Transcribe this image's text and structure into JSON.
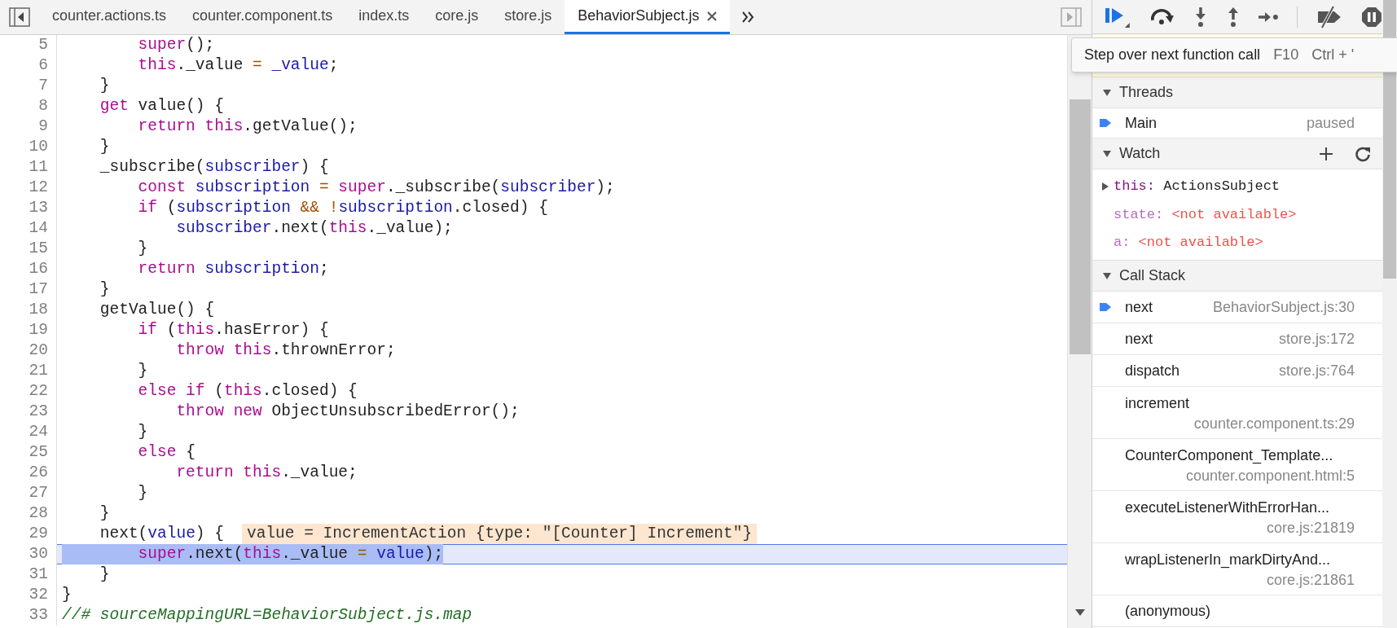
{
  "tabs": [
    {
      "label": "counter.actions.ts",
      "selected": false
    },
    {
      "label": "counter.component.ts",
      "selected": false
    },
    {
      "label": "index.ts",
      "selected": false
    },
    {
      "label": "core.js",
      "selected": false
    },
    {
      "label": "store.js",
      "selected": false
    },
    {
      "label": "BehaviorSubject.js",
      "selected": true
    }
  ],
  "editor": {
    "lines": [
      {
        "number": "5",
        "current": false,
        "tokens": [
          {
            "text": "        super",
            "kind": "keyword"
          },
          {
            "text": "();",
            "kind": "plain"
          }
        ]
      },
      {
        "number": "6",
        "current": false,
        "tokens": [
          {
            "text": "        this",
            "kind": "keyword"
          },
          {
            "text": "._value",
            "kind": "plain"
          },
          {
            "text": " =",
            "kind": "operator"
          },
          {
            "text": " _value",
            "kind": "variable"
          },
          {
            "text": ";",
            "kind": "plain"
          }
        ]
      },
      {
        "number": "7",
        "current": false,
        "tokens": [
          {
            "text": "    }",
            "kind": "plain"
          }
        ]
      },
      {
        "number": "8",
        "current": false,
        "tokens": [
          {
            "text": "    get",
            "kind": "keyword"
          },
          {
            "text": " value() {",
            "kind": "plain"
          }
        ]
      },
      {
        "number": "9",
        "current": false,
        "tokens": [
          {
            "text": "        return",
            "kind": "keyword"
          },
          {
            "text": " this",
            "kind": "keyword"
          },
          {
            "text": ".getValue();",
            "kind": "plain"
          }
        ]
      },
      {
        "number": "10",
        "current": false,
        "tokens": [
          {
            "text": "    }",
            "kind": "plain"
          }
        ]
      },
      {
        "number": "11",
        "current": false,
        "tokens": [
          {
            "text": "    _subscribe(",
            "kind": "plain"
          },
          {
            "text": "subscriber",
            "kind": "variable"
          },
          {
            "text": ") {",
            "kind": "plain"
          }
        ]
      },
      {
        "number": "12",
        "current": false,
        "tokens": [
          {
            "text": "        const",
            "kind": "keyword"
          },
          {
            "text": " subscription",
            "kind": "variable"
          },
          {
            "text": " =",
            "kind": "operator"
          },
          {
            "text": " super",
            "kind": "keyword"
          },
          {
            "text": "._subscribe(",
            "kind": "plain"
          },
          {
            "text": "subscriber",
            "kind": "variable"
          },
          {
            "text": ");",
            "kind": "plain"
          }
        ]
      },
      {
        "number": "13",
        "current": false,
        "tokens": [
          {
            "text": "        if",
            "kind": "keyword"
          },
          {
            "text": " (",
            "kind": "plain"
          },
          {
            "text": "subscription",
            "kind": "variable"
          },
          {
            "text": " && !",
            "kind": "operator"
          },
          {
            "text": "subscription",
            "kind": "variable"
          },
          {
            "text": ".closed) {",
            "kind": "plain"
          }
        ]
      },
      {
        "number": "14",
        "current": false,
        "tokens": [
          {
            "text": "            subscriber",
            "kind": "variable"
          },
          {
            "text": ".next(",
            "kind": "plain"
          },
          {
            "text": "this",
            "kind": "keyword"
          },
          {
            "text": "._value);",
            "kind": "plain"
          }
        ]
      },
      {
        "number": "15",
        "current": false,
        "tokens": [
          {
            "text": "        }",
            "kind": "plain"
          }
        ]
      },
      {
        "number": "16",
        "current": false,
        "tokens": [
          {
            "text": "        return",
            "kind": "keyword"
          },
          {
            "text": " subscription",
            "kind": "variable"
          },
          {
            "text": ";",
            "kind": "plain"
          }
        ]
      },
      {
        "number": "17",
        "current": false,
        "tokens": [
          {
            "text": "    }",
            "kind": "plain"
          }
        ]
      },
      {
        "number": "18",
        "current": false,
        "tokens": [
          {
            "text": "    getValue() {",
            "kind": "plain"
          }
        ]
      },
      {
        "number": "19",
        "current": false,
        "tokens": [
          {
            "text": "        if",
            "kind": "keyword"
          },
          {
            "text": " (",
            "kind": "plain"
          },
          {
            "text": "this",
            "kind": "keyword"
          },
          {
            "text": ".hasError) {",
            "kind": "plain"
          }
        ]
      },
      {
        "number": "20",
        "current": false,
        "tokens": [
          {
            "text": "            throw",
            "kind": "keyword"
          },
          {
            "text": " this",
            "kind": "keyword"
          },
          {
            "text": ".thrownError;",
            "kind": "plain"
          }
        ]
      },
      {
        "number": "21",
        "current": false,
        "tokens": [
          {
            "text": "        }",
            "kind": "plain"
          }
        ]
      },
      {
        "number": "22",
        "current": false,
        "tokens": [
          {
            "text": "        else if",
            "kind": "keyword"
          },
          {
            "text": " (",
            "kind": "plain"
          },
          {
            "text": "this",
            "kind": "keyword"
          },
          {
            "text": ".closed) {",
            "kind": "plain"
          }
        ]
      },
      {
        "number": "23",
        "current": false,
        "tokens": [
          {
            "text": "            throw new",
            "kind": "keyword"
          },
          {
            "text": " ObjectUnsubscribedError();",
            "kind": "plain"
          }
        ]
      },
      {
        "number": "24",
        "current": false,
        "tokens": [
          {
            "text": "        }",
            "kind": "plain"
          }
        ]
      },
      {
        "number": "25",
        "current": false,
        "tokens": [
          {
            "text": "        else",
            "kind": "keyword"
          },
          {
            "text": " {",
            "kind": "plain"
          }
        ]
      },
      {
        "number": "26",
        "current": false,
        "tokens": [
          {
            "text": "            return this",
            "kind": "keyword"
          },
          {
            "text": "._value;",
            "kind": "plain"
          }
        ]
      },
      {
        "number": "27",
        "current": false,
        "tokens": [
          {
            "text": "        }",
            "kind": "plain"
          }
        ]
      },
      {
        "number": "28",
        "current": false,
        "tokens": [
          {
            "text": "    }",
            "kind": "plain"
          }
        ]
      },
      {
        "number": "29",
        "current": false,
        "tokens": [
          {
            "text": "    next(",
            "kind": "plain"
          },
          {
            "text": "value",
            "kind": "variable"
          },
          {
            "text": ") {",
            "kind": "plain"
          }
        ],
        "inline_value": "value = IncrementAction {type: \"[Counter] Increment\"}"
      },
      {
        "number": "30",
        "current": true,
        "tokens": [
          {
            "text": "        super",
            "kind": "keyword"
          },
          {
            "text": ".next(",
            "kind": "plain"
          },
          {
            "text": "this",
            "kind": "keyword"
          },
          {
            "text": "._value",
            "kind": "plain"
          },
          {
            "text": " =",
            "kind": "operator"
          },
          {
            "text": " value",
            "kind": "variable"
          },
          {
            "text": ");",
            "kind": "plain"
          }
        ]
      },
      {
        "number": "31",
        "current": false,
        "tokens": [
          {
            "text": "    }",
            "kind": "plain"
          }
        ]
      },
      {
        "number": "32",
        "current": false,
        "tokens": [
          {
            "text": "}",
            "kind": "plain"
          }
        ]
      },
      {
        "number": "33",
        "current": false,
        "tokens": [
          {
            "text": "//# sourceMappingURL=BehaviorSubject.js.map",
            "kind": "comment"
          }
        ]
      }
    ]
  },
  "debugger": {
    "tooltip": {
      "text": "Step over next function call",
      "shortcuts": [
        "F10",
        "Ctrl + '"
      ]
    },
    "threads": {
      "title": "Threads",
      "expanded": true,
      "items": [
        {
          "name": "Main",
          "status": "paused",
          "current": true
        }
      ]
    },
    "watch": {
      "title": "Watch",
      "expanded": true,
      "items": [
        {
          "kind": "object",
          "name": "this:",
          "value": "ActionsSubject",
          "expanded": false
        },
        {
          "kind": "unavailable",
          "name": "state:",
          "value": "<not available>"
        },
        {
          "kind": "unavailable",
          "name": "a:",
          "value": "<not available>"
        }
      ]
    },
    "call_stack": {
      "title": "Call Stack",
      "expanded": true,
      "frames": [
        {
          "kind": "inline",
          "name": "next",
          "location": "BehaviorSubject.js:30",
          "current": true
        },
        {
          "kind": "inline",
          "name": "next",
          "location": "store.js:172",
          "current": false
        },
        {
          "kind": "inline",
          "name": "dispatch",
          "location": "store.js:764",
          "current": false
        },
        {
          "kind": "stacked",
          "name": "increment",
          "location": "counter.component.ts:29",
          "current": false
        },
        {
          "kind": "stacked",
          "name": "CounterComponent_Template...",
          "location": "counter.component.html:5",
          "current": false
        },
        {
          "kind": "stacked",
          "name": "executeListenerWithErrorHan...",
          "location": "core.js:21819",
          "current": false
        },
        {
          "kind": "stacked",
          "name": "wrapListenerIn_markDirtyAnd...",
          "location": "core.js:21861",
          "current": false
        },
        {
          "kind": "inline",
          "name": "(anonymous)",
          "current": false
        }
      ]
    }
  }
}
